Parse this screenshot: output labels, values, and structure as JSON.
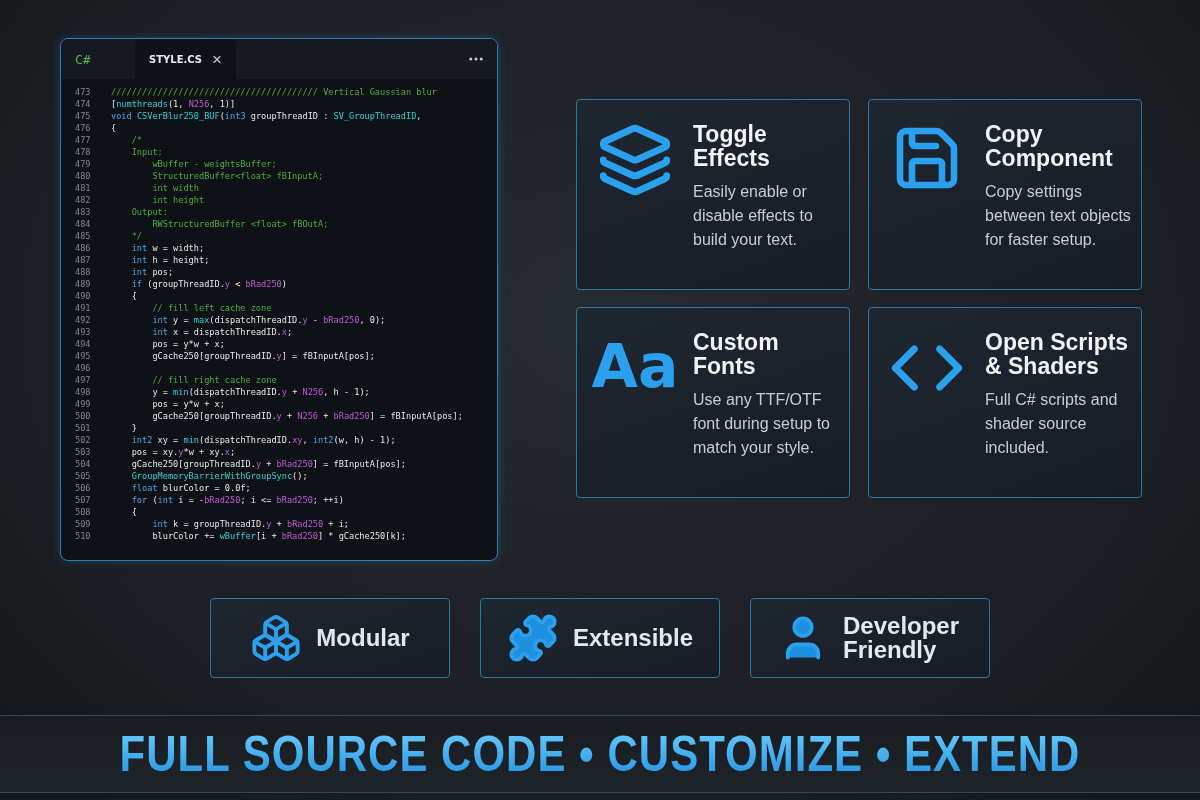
{
  "editor": {
    "language": "C#",
    "tabs": [
      {
        "label": "STYLE.CS",
        "selected": true,
        "close": "×"
      }
    ],
    "lines": [
      {
        "number": "473",
        "tokens": [
          {
            "kind": "comment",
            "text": "//////////////////////////////////////// Vertical Gaussian blur"
          }
        ]
      },
      {
        "number": "474",
        "tokens": [
          {
            "kind": "plain",
            "text": "["
          },
          {
            "kind": "func",
            "text": "numthreads"
          },
          {
            "kind": "plain",
            "text": "(1, "
          },
          {
            "kind": "macro",
            "text": "N256"
          },
          {
            "kind": "plain",
            "text": ", 1)]"
          }
        ]
      },
      {
        "number": "475",
        "tokens": [
          {
            "kind": "keyword",
            "text": "void "
          },
          {
            "kind": "func",
            "text": "CSVerBlur250_BUF"
          },
          {
            "kind": "plain",
            "text": "("
          },
          {
            "kind": "keyword",
            "text": "int3"
          },
          {
            "kind": "plain",
            "text": " groupThreadID : "
          },
          {
            "kind": "func",
            "text": "SV_GroupThreadID"
          },
          {
            "kind": "plain",
            "text": ","
          }
        ]
      },
      {
        "number": "476",
        "tokens": [
          {
            "kind": "plain",
            "text": "{"
          }
        ]
      },
      {
        "number": "477",
        "tokens": [
          {
            "kind": "comment",
            "text": "    /*"
          }
        ]
      },
      {
        "number": "478",
        "tokens": [
          {
            "kind": "comment",
            "text": "    Input:"
          }
        ]
      },
      {
        "number": "479",
        "tokens": [
          {
            "kind": "comment",
            "text": "        wBuffer - weightsBuffer;"
          }
        ]
      },
      {
        "number": "480",
        "tokens": [
          {
            "kind": "comment",
            "text": "        StructuredBuffer<float> fBInputA;"
          }
        ]
      },
      {
        "number": "481",
        "tokens": [
          {
            "kind": "comment",
            "text": "        int width"
          }
        ]
      },
      {
        "number": "482",
        "tokens": [
          {
            "kind": "comment",
            "text": "        int height"
          }
        ]
      },
      {
        "number": "483",
        "tokens": [
          {
            "kind": "comment",
            "text": "    Output:"
          }
        ]
      },
      {
        "number": "484",
        "tokens": [
          {
            "kind": "comment",
            "text": "        RWStructuredBuffer <float> fBOutA;"
          }
        ]
      },
      {
        "number": "485",
        "tokens": [
          {
            "kind": "comment",
            "text": "    */"
          }
        ]
      },
      {
        "number": "486",
        "tokens": [
          {
            "kind": "keyword",
            "text": "    int"
          },
          {
            "kind": "plain",
            "text": " w = width;"
          }
        ]
      },
      {
        "number": "487",
        "tokens": [
          {
            "kind": "keyword",
            "text": "    int"
          },
          {
            "kind": "plain",
            "text": " h = height;"
          }
        ]
      },
      {
        "number": "488",
        "tokens": [
          {
            "kind": "keyword",
            "text": "    int"
          },
          {
            "kind": "plain",
            "text": " pos;"
          }
        ]
      },
      {
        "number": "489",
        "tokens": [
          {
            "kind": "keyword",
            "text": "    if"
          },
          {
            "kind": "plain",
            "text": " (groupThreadID."
          },
          {
            "kind": "macro",
            "text": "y"
          },
          {
            "kind": "plain",
            "text": " < "
          },
          {
            "kind": "macro",
            "text": "bRad250"
          },
          {
            "kind": "plain",
            "text": ")"
          }
        ]
      },
      {
        "number": "490",
        "tokens": [
          {
            "kind": "plain",
            "text": "    {"
          }
        ]
      },
      {
        "number": "491",
        "tokens": [
          {
            "kind": "comment",
            "text": "        // fill left cache zone"
          }
        ]
      },
      {
        "number": "492",
        "tokens": [
          {
            "kind": "keyword",
            "text": "        int"
          },
          {
            "kind": "plain",
            "text": " y = "
          },
          {
            "kind": "func",
            "text": "max"
          },
          {
            "kind": "plain",
            "text": "(dispatchThreadID."
          },
          {
            "kind": "macro",
            "text": "y"
          },
          {
            "kind": "plain",
            "text": " - "
          },
          {
            "kind": "macro",
            "text": "bRad250"
          },
          {
            "kind": "plain",
            "text": ", 0);"
          }
        ]
      },
      {
        "number": "493",
        "tokens": [
          {
            "kind": "keyword",
            "text": "        int"
          },
          {
            "kind": "plain",
            "text": " x = dispatchThreadID."
          },
          {
            "kind": "macro",
            "text": "x"
          },
          {
            "kind": "plain",
            "text": ";"
          }
        ]
      },
      {
        "number": "494",
        "tokens": [
          {
            "kind": "plain",
            "text": "        pos = y*w + x;"
          }
        ]
      },
      {
        "number": "495",
        "tokens": [
          {
            "kind": "plain",
            "text": "        gCache250[groupThreadID."
          },
          {
            "kind": "macro",
            "text": "y"
          },
          {
            "kind": "plain",
            "text": "] = fBInputA[pos];"
          }
        ]
      },
      {
        "number": "496"
      },
      {
        "number": "497",
        "tokens": [
          {
            "kind": "comment",
            "text": "        // fill right cache zone"
          }
        ]
      },
      {
        "number": "498",
        "tokens": [
          {
            "kind": "plain",
            "text": "        y = "
          },
          {
            "kind": "func",
            "text": "min"
          },
          {
            "kind": "plain",
            "text": "(dispatchThreadID."
          },
          {
            "kind": "macro",
            "text": "y"
          },
          {
            "kind": "plain",
            "text": " + "
          },
          {
            "kind": "macro",
            "text": "N256"
          },
          {
            "kind": "plain",
            "text": ", h - 1);"
          }
        ]
      },
      {
        "number": "499",
        "tokens": [
          {
            "kind": "plain",
            "text": "        pos = y*w + x;"
          }
        ]
      },
      {
        "number": "500",
        "tokens": [
          {
            "kind": "plain",
            "text": "        gCache250[groupThreadID."
          },
          {
            "kind": "macro",
            "text": "y"
          },
          {
            "kind": "plain",
            "text": " + "
          },
          {
            "kind": "macro",
            "text": "N256"
          },
          {
            "kind": "plain",
            "text": " + "
          },
          {
            "kind": "macro",
            "text": "bRad250"
          },
          {
            "kind": "plain",
            "text": "] = fBInputA[pos];"
          }
        ]
      },
      {
        "number": "501",
        "tokens": [
          {
            "kind": "plain",
            "text": "    }"
          }
        ]
      },
      {
        "number": "502",
        "tokens": [
          {
            "kind": "keyword",
            "text": "    int2"
          },
          {
            "kind": "plain",
            "text": " xy = "
          },
          {
            "kind": "func",
            "text": "min"
          },
          {
            "kind": "plain",
            "text": "(dispatchThreadID."
          },
          {
            "kind": "macro",
            "text": "xy"
          },
          {
            "kind": "plain",
            "text": ", "
          },
          {
            "kind": "keyword",
            "text": "int2"
          },
          {
            "kind": "plain",
            "text": "(w, h) - 1);"
          }
        ]
      },
      {
        "number": "503",
        "tokens": [
          {
            "kind": "plain",
            "text": "    pos = xy."
          },
          {
            "kind": "macro",
            "text": "y"
          },
          {
            "kind": "plain",
            "text": "*w + xy."
          },
          {
            "kind": "macro",
            "text": "x"
          },
          {
            "kind": "plain",
            "text": ";"
          }
        ]
      },
      {
        "number": "504",
        "tokens": [
          {
            "kind": "plain",
            "text": "    gCache250[groupThreadID."
          },
          {
            "kind": "macro",
            "text": "y"
          },
          {
            "kind": "plain",
            "text": " + "
          },
          {
            "kind": "macro",
            "text": "bRad250"
          },
          {
            "kind": "plain",
            "text": "] = fBInputA[pos];"
          }
        ]
      },
      {
        "number": "505",
        "tokens": [
          {
            "kind": "func",
            "text": "    GroupMemoryBarrierWithGroupSync"
          },
          {
            "kind": "plain",
            "text": "();"
          }
        ]
      },
      {
        "number": "506",
        "tokens": [
          {
            "kind": "keyword",
            "text": "    float"
          },
          {
            "kind": "plain",
            "text": " blurColor = 0.0f;"
          }
        ]
      },
      {
        "number": "507",
        "tokens": [
          {
            "kind": "keyword",
            "text": "    for"
          },
          {
            "kind": "plain",
            "text": " ("
          },
          {
            "kind": "keyword",
            "text": "int"
          },
          {
            "kind": "plain",
            "text": " i = -"
          },
          {
            "kind": "macro",
            "text": "bRad250"
          },
          {
            "kind": "plain",
            "text": "; i <= "
          },
          {
            "kind": "macro",
            "text": "bRad250"
          },
          {
            "kind": "plain",
            "text": "; ++i)"
          }
        ]
      },
      {
        "number": "508",
        "tokens": [
          {
            "kind": "plain",
            "text": "    {"
          }
        ]
      },
      {
        "number": "509",
        "tokens": [
          {
            "kind": "keyword",
            "text": "        int"
          },
          {
            "kind": "plain",
            "text": " k = groupThreadID."
          },
          {
            "kind": "macro",
            "text": "y"
          },
          {
            "kind": "plain",
            "text": " + "
          },
          {
            "kind": "macro",
            "text": "bRad250"
          },
          {
            "kind": "plain",
            "text": " + i;"
          }
        ]
      },
      {
        "number": "510",
        "tokens": [
          {
            "kind": "plain",
            "text": "        blurColor += "
          },
          {
            "kind": "func",
            "text": "wBuffer"
          },
          {
            "kind": "plain",
            "text": "[i + "
          },
          {
            "kind": "macro",
            "text": "bRad250"
          },
          {
            "kind": "plain",
            "text": "] * gCache250[k];"
          }
        ]
      }
    ]
  },
  "features": [
    {
      "title": "Toggle Effects",
      "description": "Easily enable or disable effects to build your text."
    },
    {
      "title": "Copy Component",
      "description": "Copy settings between text objects for faster setup."
    },
    {
      "title": "Custom Fonts",
      "icon_text": "Aa",
      "description": "Use any TTF/OTF font during setup to match your style."
    },
    {
      "title": "Open Scripts & Shaders",
      "description": "Full C# scripts and shader source included."
    }
  ],
  "badges": [
    {
      "label": "Modular"
    },
    {
      "label": "Extensible"
    },
    {
      "label": "Developer Friendly"
    }
  ],
  "banner": "FULL SOURCE CODE • CUSTOMIZE • EXTEND"
}
